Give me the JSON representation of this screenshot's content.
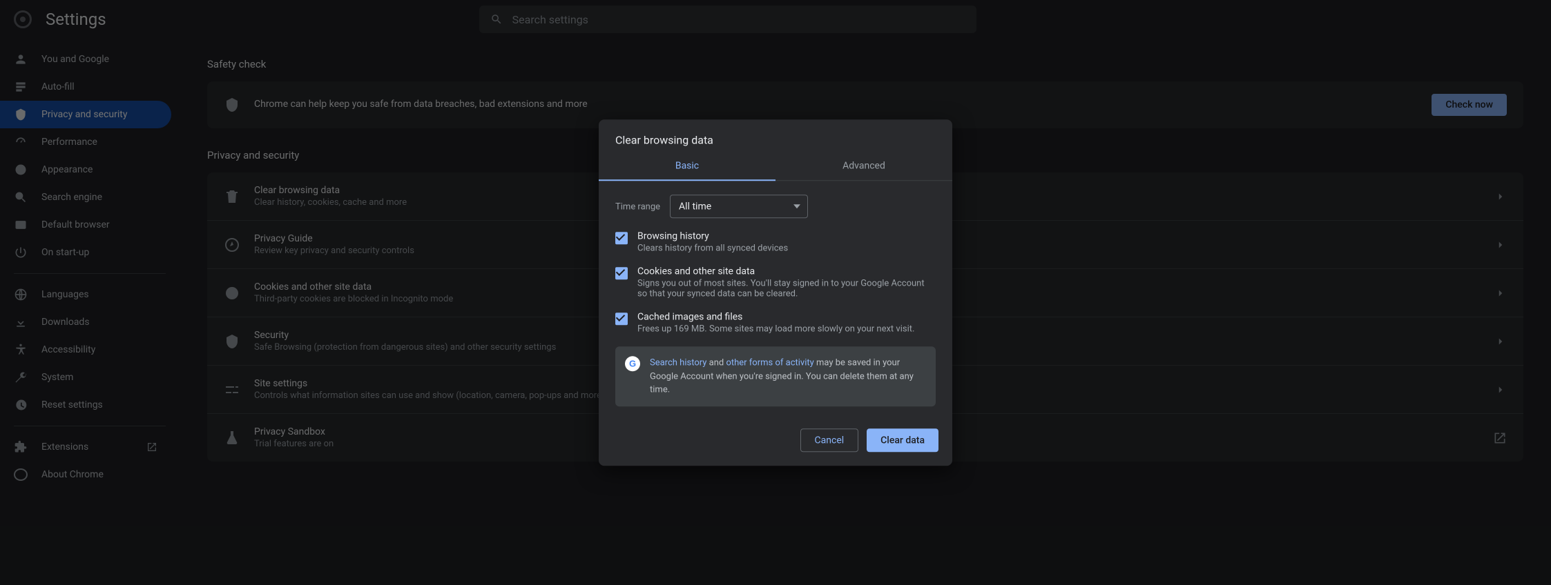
{
  "app_title": "Settings",
  "search_placeholder": "Search settings",
  "sidebar": {
    "items": [
      {
        "label": "You and Google"
      },
      {
        "label": "Auto-fill"
      },
      {
        "label": "Privacy and security"
      },
      {
        "label": "Performance"
      },
      {
        "label": "Appearance"
      },
      {
        "label": "Search engine"
      },
      {
        "label": "Default browser"
      },
      {
        "label": "On start-up"
      }
    ],
    "group2": [
      {
        "label": "Languages"
      },
      {
        "label": "Downloads"
      },
      {
        "label": "Accessibility"
      },
      {
        "label": "System"
      },
      {
        "label": "Reset settings"
      }
    ],
    "group3": [
      {
        "label": "Extensions"
      },
      {
        "label": "About Chrome"
      }
    ]
  },
  "sections": {
    "safety_title": "Safety check",
    "safety_desc": "Chrome can help keep you safe from data breaches, bad extensions and more",
    "check_now": "Check now",
    "privacy_title": "Privacy and security",
    "rows": [
      {
        "title": "Clear browsing data",
        "sub": "Clear history, cookies, cache and more"
      },
      {
        "title": "Privacy Guide",
        "sub": "Review key privacy and security controls"
      },
      {
        "title": "Cookies and other site data",
        "sub": "Third-party cookies are blocked in Incognito mode"
      },
      {
        "title": "Security",
        "sub": "Safe Browsing (protection from dangerous sites) and other security settings"
      },
      {
        "title": "Site settings",
        "sub": "Controls what information sites can use and show (location, camera, pop-ups and more)"
      },
      {
        "title": "Privacy Sandbox",
        "sub": "Trial features are on"
      }
    ]
  },
  "dialog": {
    "title": "Clear browsing data",
    "tabs": {
      "basic": "Basic",
      "advanced": "Advanced"
    },
    "time_range_label": "Time range",
    "time_range_value": "All time",
    "options": [
      {
        "title": "Browsing history",
        "sub": "Clears history from all synced devices"
      },
      {
        "title": "Cookies and other site data",
        "sub": "Signs you out of most sites. You'll stay signed in to your Google Account so that your synced data can be cleared."
      },
      {
        "title": "Cached images and files",
        "sub": "Frees up 169 MB. Some sites may load more slowly on your next visit."
      }
    ],
    "google_note": {
      "search_history": "Search history",
      "and": " and ",
      "other_forms": "other forms of activity",
      "rest": " may be saved in your Google Account when you're signed in. You can delete them at any time."
    },
    "cancel": "Cancel",
    "clear": "Clear data"
  }
}
